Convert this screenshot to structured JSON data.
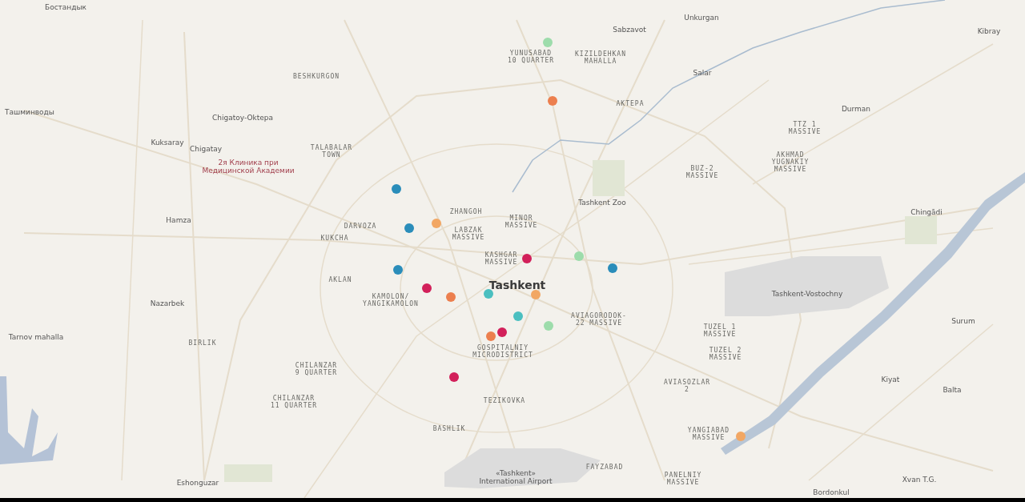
{
  "map": {
    "labels": [
      {
        "kind": "place",
        "lines": [
          "Бостандык"
        ]
      },
      {
        "kind": "place",
        "lines": [
          "Unkurgan"
        ]
      },
      {
        "kind": "place",
        "lines": [
          "Sabzavot"
        ]
      },
      {
        "kind": "place",
        "lines": [
          "Kibray"
        ]
      },
      {
        "kind": "district",
        "lines": [
          "YUNUSABAD",
          "10 QUARTER"
        ]
      },
      {
        "kind": "district",
        "lines": [
          "KIZILDEHKAN",
          "MAHALLA"
        ]
      },
      {
        "kind": "district",
        "lines": [
          "BESHKURGON"
        ]
      },
      {
        "kind": "place",
        "lines": [
          "Salar"
        ]
      },
      {
        "kind": "place",
        "lines": [
          "Ташминводы"
        ]
      },
      {
        "kind": "district",
        "lines": [
          "AKTEPA"
        ]
      },
      {
        "kind": "place",
        "lines": [
          "Durman"
        ]
      },
      {
        "kind": "place",
        "lines": [
          "Chigatoy-Oktepa"
        ]
      },
      {
        "kind": "district",
        "lines": [
          "TTZ 1",
          "MASSIVE"
        ]
      },
      {
        "kind": "place",
        "lines": [
          "Kuksaray"
        ]
      },
      {
        "kind": "place",
        "lines": [
          "Chigatay"
        ]
      },
      {
        "kind": "district",
        "lines": [
          "TALABALAR",
          "TOWN"
        ]
      },
      {
        "kind": "poi",
        "lines": [
          "2я Клиника при",
          "Медицинской Академии"
        ]
      },
      {
        "kind": "district",
        "lines": [
          "BUZ-2",
          "MASSIVE"
        ]
      },
      {
        "kind": "district",
        "lines": [
          "AKHMAD",
          "YUGNAKIY",
          "MASSIVE"
        ]
      },
      {
        "kind": "place",
        "lines": [
          "Tashkent Zoo"
        ]
      },
      {
        "kind": "district",
        "lines": [
          "ZHANGOH"
        ]
      },
      {
        "kind": "place",
        "lines": [
          "Chingādi"
        ]
      },
      {
        "kind": "place",
        "lines": [
          "Hamza"
        ]
      },
      {
        "kind": "district",
        "lines": [
          "DARVOZA"
        ]
      },
      {
        "kind": "district",
        "lines": [
          "MINOR",
          "MASSIVE"
        ]
      },
      {
        "kind": "district",
        "lines": [
          "KUKCHA"
        ]
      },
      {
        "kind": "district",
        "lines": [
          "LABZAK",
          "MASSIVE"
        ]
      },
      {
        "kind": "district",
        "lines": [
          "KASHGAR",
          "MASSIVE"
        ]
      },
      {
        "kind": "district",
        "lines": [
          "AKLAN"
        ]
      },
      {
        "kind": "city",
        "lines": [
          "Tashkent"
        ]
      },
      {
        "kind": "place",
        "lines": [
          "Nazarbek"
        ]
      },
      {
        "kind": "district",
        "lines": [
          "KAMOLON/",
          "YANGIKAMOLON"
        ]
      },
      {
        "kind": "place",
        "lines": [
          "Tashkent-Vostochny"
        ]
      },
      {
        "kind": "district",
        "lines": [
          "AVIAGORODOK-",
          "22 MASSIVE"
        ]
      },
      {
        "kind": "place",
        "lines": [
          "Surum"
        ]
      },
      {
        "kind": "place",
        "lines": [
          "Tarnov mahalla"
        ]
      },
      {
        "kind": "district",
        "lines": [
          "TUZEL 1",
          "MASSIVE"
        ]
      },
      {
        "kind": "district",
        "lines": [
          "BIRLIK"
        ]
      },
      {
        "kind": "district",
        "lines": [
          "GOSPITALNIY",
          "MICRODISTRICT"
        ]
      },
      {
        "kind": "district",
        "lines": [
          "TUZEL 2",
          "MASSIVE"
        ]
      },
      {
        "kind": "district",
        "lines": [
          "CHILANZAR",
          "9 QUARTER"
        ]
      },
      {
        "kind": "district",
        "lines": [
          "AVIASOZLAR",
          "2"
        ]
      },
      {
        "kind": "place",
        "lines": [
          "Kiyat"
        ]
      },
      {
        "kind": "place",
        "lines": [
          "Balta"
        ]
      },
      {
        "kind": "district",
        "lines": [
          "CHILANZAR",
          "11 QUARTER"
        ]
      },
      {
        "kind": "district",
        "lines": [
          "TEZIKOVKA"
        ]
      },
      {
        "kind": "district",
        "lines": [
          "BASHLIK"
        ]
      },
      {
        "kind": "district",
        "lines": [
          "YANGIABAD",
          "MASSIVE"
        ]
      },
      {
        "kind": "place",
        "lines": [
          "Eshonguzar"
        ]
      },
      {
        "kind": "place",
        "lines": [
          "«Tashkent»",
          "International Airport"
        ]
      },
      {
        "kind": "district",
        "lines": [
          "FAYZABAD"
        ]
      },
      {
        "kind": "district",
        "lines": [
          "PANELNIY",
          "MASSIVE"
        ]
      },
      {
        "kind": "place",
        "lines": [
          "Bordonkul"
        ]
      },
      {
        "kind": "place",
        "lines": [
          "Xvan T.G."
        ]
      }
    ],
    "markers": [
      {
        "color": "#9ddcab"
      },
      {
        "color": "#ec7f4e"
      },
      {
        "color": "#2a8dba"
      },
      {
        "color": "#2a8dba"
      },
      {
        "color": "#f2a764"
      },
      {
        "color": "#2a8dba"
      },
      {
        "color": "#d2205a"
      },
      {
        "color": "#9ddcab"
      },
      {
        "color": "#2a8dba"
      },
      {
        "color": "#d2205a"
      },
      {
        "color": "#ec7f4e"
      },
      {
        "color": "#4bbfc0"
      },
      {
        "color": "#f2a764"
      },
      {
        "color": "#4bbfc0"
      },
      {
        "color": "#9ddcab"
      },
      {
        "color": "#d2205a"
      },
      {
        "color": "#ec7f4e"
      },
      {
        "color": "#d2205a"
      },
      {
        "color": "#f2a764"
      }
    ]
  }
}
